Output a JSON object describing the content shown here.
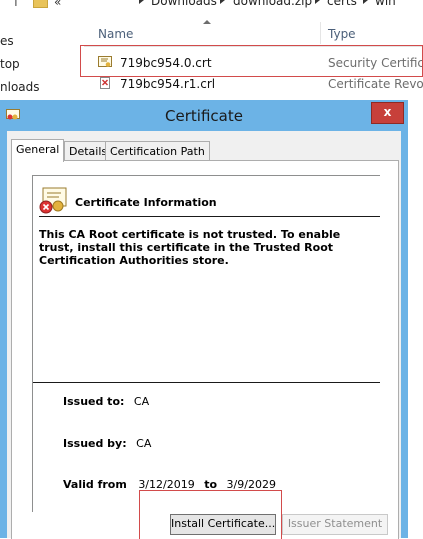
{
  "explorer": {
    "breadcrumb": [
      "Downloads",
      "download.zip",
      "certs",
      "win"
    ],
    "overflow_glyph": "«",
    "nav_items": [
      "es",
      "top",
      "nloads"
    ],
    "columns": {
      "name": "Name",
      "type": "Type"
    },
    "files": [
      {
        "name": "719bc954.0.crt",
        "type": "Security Certificat",
        "icon": "certificate-file-icon",
        "selected": true
      },
      {
        "name": "719bc954.r1.crl",
        "type": "Certificate Revoca",
        "icon": "revocation-list-file-icon",
        "selected": false
      }
    ]
  },
  "dialog": {
    "title": "Certificate",
    "close_glyph": "x",
    "tabs": [
      "General",
      "Details",
      "Certification Path"
    ],
    "active_tab": "General",
    "info_title": "Certificate Information",
    "warning": "This CA Root certificate is not trusted. To enable trust, install this certificate in the Trusted Root Certification Authorities store.",
    "issued_to_label": "Issued to:",
    "issued_to": "CA",
    "issued_by_label": "Issued by:",
    "issued_by": "CA",
    "valid_from_label": "Valid from",
    "valid_from": "3/12/2019",
    "valid_to_label": "to",
    "valid_to": "3/9/2029",
    "install_button": "Install Certificate...",
    "issuer_button": "Issuer Statement"
  },
  "colors": {
    "highlight": "#d24b4b",
    "titlebar": "#6cb3e6",
    "close": "#c7403a"
  }
}
